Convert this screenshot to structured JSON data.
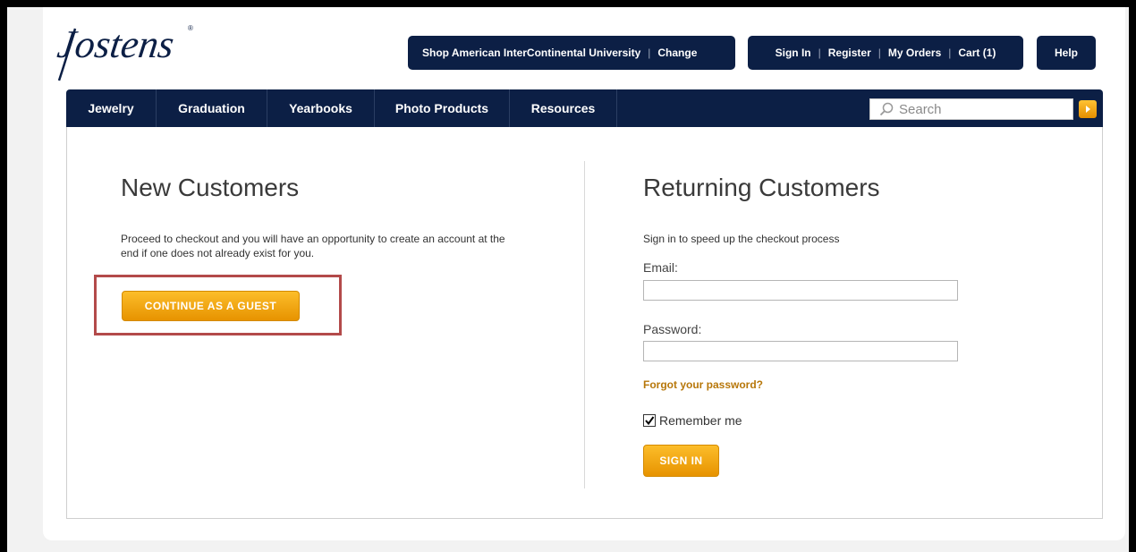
{
  "brand": {
    "logo_text": "Jostens"
  },
  "header": {
    "shop_label": "Shop American InterContinental University",
    "change_label": "Change",
    "sign_in": "Sign In",
    "register": "Register",
    "my_orders": "My Orders",
    "cart": "Cart (1)",
    "help": "Help"
  },
  "nav": {
    "items": [
      {
        "label": "Jewelry"
      },
      {
        "label": "Graduation"
      },
      {
        "label": "Yearbooks"
      },
      {
        "label": "Photo Products"
      },
      {
        "label": "Resources"
      }
    ],
    "search_placeholder": "Search"
  },
  "new_customers": {
    "title": "New Customers",
    "description": "Proceed to checkout and you will have an opportunity to create an account at the end if one does not already exist for you.",
    "guest_button": "CONTINUE AS A GUEST"
  },
  "returning_customers": {
    "title": "Returning Customers",
    "subtitle": "Sign in to speed up the checkout process",
    "email_label": "Email:",
    "email_value": "",
    "password_label": "Password:",
    "password_value": "",
    "forgot_link": "Forgot your password?",
    "remember_label": "Remember me",
    "remember_checked": true,
    "sign_in_button": "SIGN IN"
  },
  "colors": {
    "navy": "#0c1f45",
    "accent_orange": "#f0a30a",
    "link_gold": "#b7770a",
    "highlight_red": "#b34a4a"
  }
}
